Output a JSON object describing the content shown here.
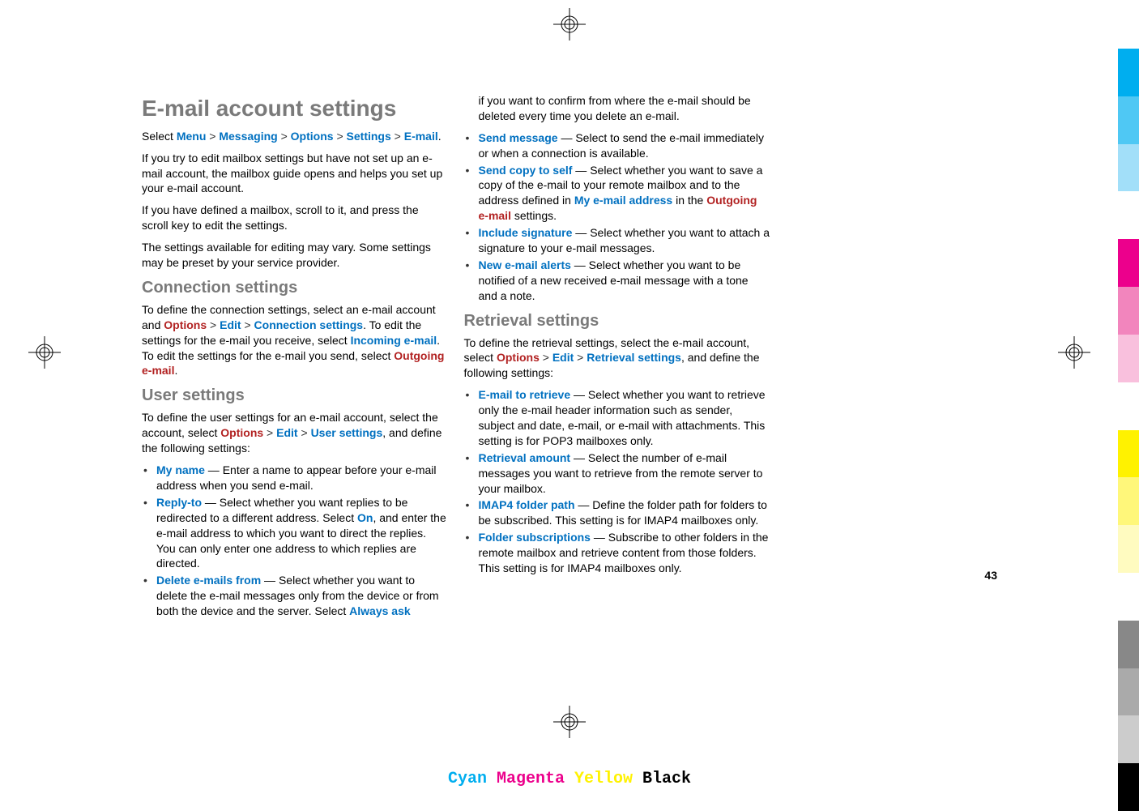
{
  "heading1": "E-mail account settings",
  "intro": {
    "p1_prefix": "Select ",
    "menu": "Menu",
    "messaging": "Messaging",
    "options": "Options",
    "settings": "Settings",
    "email": "E-mail",
    "p1_suffix": ".",
    "p2": "If you try to edit mailbox settings but have not set up an e-mail account, the mailbox guide opens and helps you set up your e-mail account.",
    "p3": "If you have defined a mailbox, scroll to it, and press the scroll key to edit the settings.",
    "p4": "The settings available for editing may vary. Some settings may be preset by your service provider."
  },
  "connection": {
    "heading": "Connection settings",
    "p1a": "To define the connection settings, select an e-mail account and ",
    "options": "Options",
    "edit": "Edit",
    "csettings": "Connection settings",
    "p1b": ". To edit the settings for the e-mail you receive, select ",
    "incoming": "Incoming e-mail",
    "p1c": ". To edit the settings for the e-mail you send, select ",
    "outgoing": "Outgoing e-mail",
    "p1d": "."
  },
  "user": {
    "heading": "User settings",
    "p1a": "To define the user settings for an e-mail account, select the account, select ",
    "options": "Options",
    "edit": "Edit",
    "usettings": "User settings",
    "p1b": ", and define the following settings:",
    "li1_k": "My name",
    "li1_v": " — Enter a name to appear before your e-mail address when you send e-mail.",
    "li2_k": "Reply-to",
    "li2_v1": " — Select whether you want replies to be redirected to a different address. Select ",
    "li2_on": "On",
    "li2_v2": ", and enter the e-mail address to which you want to direct the replies. You can only enter one address to which replies are directed.",
    "li3_k": "Delete e-mails from",
    "li3_v1": " — Select whether you want to delete the e-mail messages only from the device or from both the device and the server. Select ",
    "li3_ask": "Always ask",
    "li3_v2": " if you want to confirm from where the e-mail should be deleted every time you delete an e-mail.",
    "li4_k": "Send message",
    "li4_v": " — Select to send the e-mail immediately or when a connection is available.",
    "li5_k": "Send copy to self",
    "li5_v1": " — Select whether you want to save a copy of the e-mail to your remote mailbox and to the address defined in ",
    "li5_addr": "My e-mail address",
    "li5_v2": " in the ",
    "li5_out": "Outgoing e-mail",
    "li5_v3": " settings.",
    "li6_k": "Include signature",
    "li6_v": " — Select whether you want to attach a signature to your e-mail messages.",
    "li7_k": "New e-mail alerts",
    "li7_v": " — Select whether you want to be notified of a new received e-mail message with a tone and a note."
  },
  "retrieval": {
    "heading": "Retrieval settings",
    "p1a": "To define the retrieval settings, select the e-mail account, select ",
    "options": "Options",
    "edit": "Edit",
    "rsettings": "Retrieval settings",
    "p1b": ", and define the following settings:",
    "li1_k": "E-mail to retrieve",
    "li1_v": " — Select whether you want to retrieve only the e-mail header information such as sender, subject and date, e-mail, or e-mail with attachments. This setting is for POP3 mailboxes only.",
    "li2_k": "Retrieval amount",
    "li2_v": " — Select the number of e-mail messages you want to retrieve from the remote server to your mailbox.",
    "li3_k": "IMAP4 folder path",
    "li3_v": " — Define the folder path for folders to be subscribed. This setting is for IMAP4 mailboxes only.",
    "li4_k": "Folder subscriptions",
    "li4_v": " — Subscribe to other folders in the remote mailbox and retrieve content from those folders. This setting is for IMAP4 mailboxes only."
  },
  "gt": " > ",
  "page_number": "43",
  "cmyk": {
    "c": "Cyan",
    "m": "Magenta",
    "y": "Yellow",
    "k": "Black"
  }
}
